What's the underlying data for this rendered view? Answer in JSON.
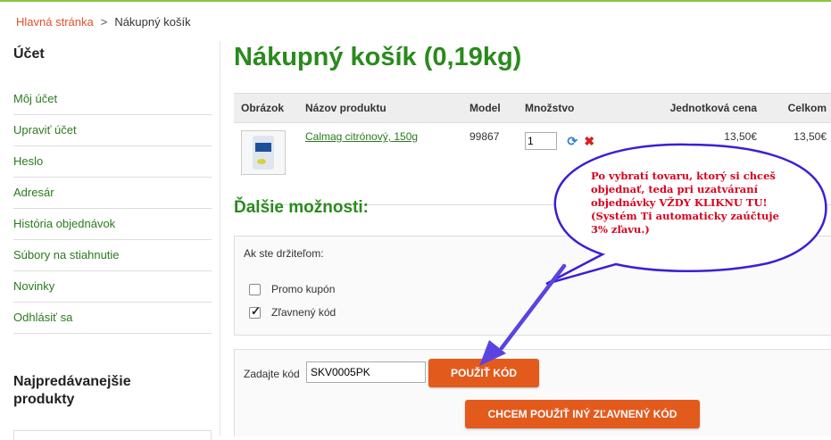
{
  "breadcrumb": {
    "home": "Hlavná stránka",
    "separator": ">",
    "current": "Nákupný košík"
  },
  "sidebar": {
    "title": "Účet",
    "items": [
      {
        "label": "Môj účet"
      },
      {
        "label": "Upraviť účet"
      },
      {
        "label": "Heslo"
      },
      {
        "label": "Adresár"
      },
      {
        "label": "História objednávok"
      },
      {
        "label": "Súbory na stiahnutie"
      },
      {
        "label": "Novinky"
      },
      {
        "label": "Odhlásiť sa"
      }
    ],
    "bestsellers_title": "Najpredávanejšie produkty"
  },
  "page": {
    "title": "Nákupný košík  (0,19kg)"
  },
  "cart": {
    "headers": [
      "Obrázok",
      "Názov produktu",
      "Model",
      "Množstvo",
      "Jednotková cena",
      "Celkom"
    ],
    "rows": [
      {
        "name": "Calmag citrónový, 150g",
        "model": "99867",
        "qty": "1",
        "unit_price": "13,50€",
        "total": "13,50€",
        "thumb_icon": "product-thumbnail"
      }
    ]
  },
  "options": {
    "title": "Ďalšie možnosti:",
    "holder_label": "Ak ste držiteľom:",
    "promo_label": "Promo kupón",
    "promo_checked": false,
    "discount_label": "Zľavnený kód",
    "discount_checked": true
  },
  "coupon": {
    "label": "Zadajte kód",
    "value": "SKV0005PK",
    "apply_button": "POUŽIŤ KÓD",
    "other_button": "CHCEM POUŽIŤ INÝ ZĽAVNENÝ KÓD"
  },
  "annotation": {
    "text": "Po vybratí tovaru, ktorý si chceš objednať, teda pri uzatváraní objednávky VŽDY KLIKNU TU! (Systém Ti automaticky zaúčtuje 3% zľavu.)",
    "bubble_color": "#3a1fd6",
    "text_color": "#d8001d"
  },
  "colors": {
    "accent_green": "#2a8a1d",
    "link_orange": "#e0502d",
    "button_orange": "#e35a1d"
  }
}
